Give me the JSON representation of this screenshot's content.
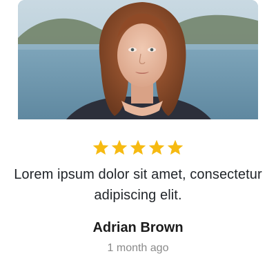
{
  "review_card": {
    "photo_icon": "person-portrait-image",
    "rating": 5,
    "rating_max": 5,
    "star_color": "#F6BA12",
    "text": "Lorem ipsum dolor sit amet, consectetur adipiscing elit.",
    "author": "Adrian Brown",
    "time": "1 month ago"
  }
}
